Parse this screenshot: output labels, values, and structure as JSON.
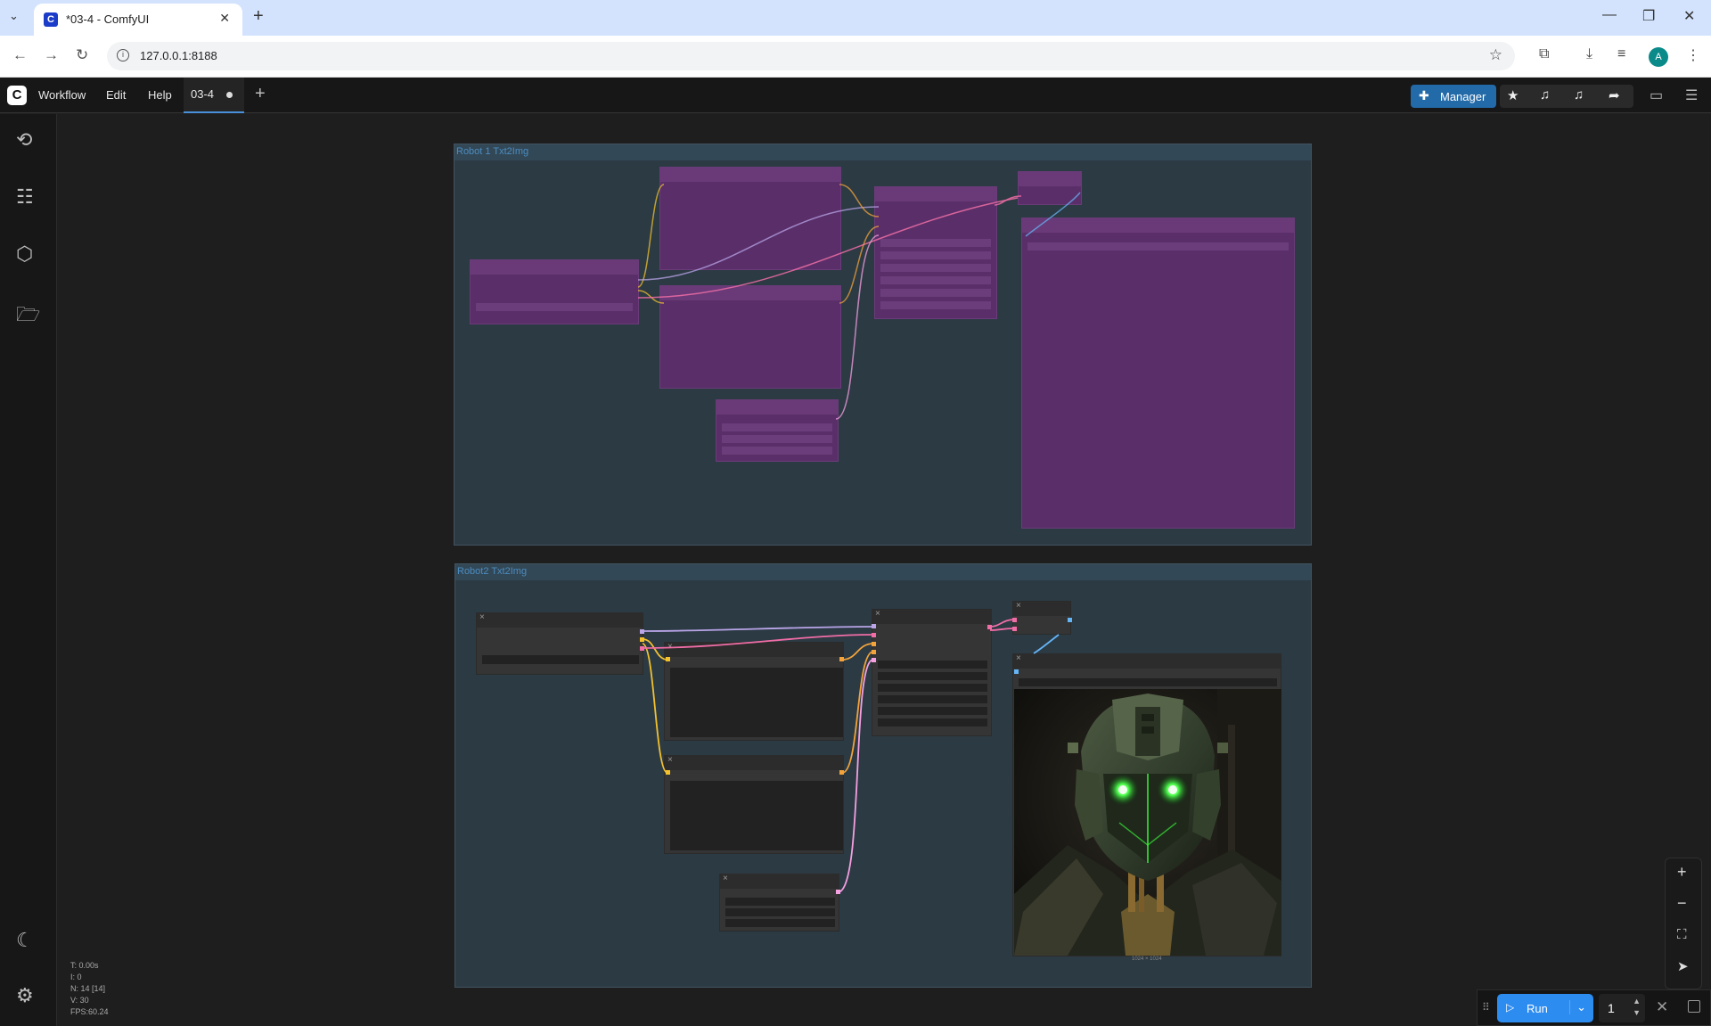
{
  "browser": {
    "tab_title": "*03-4 - ComfyUI",
    "url": "127.0.0.1:8188",
    "profile_initial": "A"
  },
  "app": {
    "menu": [
      "Workflow",
      "Edit",
      "Help"
    ],
    "workflow_tab": "03-4",
    "manager_label": "Manager"
  },
  "canvas": {
    "groups": [
      {
        "title": "Robot 1 Txt2Img",
        "state": "bypassed"
      },
      {
        "title": "Robot2 Txt2Img",
        "state": "active"
      }
    ],
    "image_caption": "1024 × 1024"
  },
  "stats": {
    "t": "T: 0.00s",
    "i": "I: 0",
    "n": "N: 14 [14]",
    "v": "V: 30",
    "fps": "FPS:60.24"
  },
  "run": {
    "label": "Run",
    "count": "1"
  },
  "colors": {
    "bypass_purple": "#5a2f69",
    "group_bg": "#2c3a44",
    "accent_blue": "#2d8cf0",
    "wire_yellow": "#f2c12e",
    "wire_pink": "#f06da6",
    "wire_lavender": "#b9a5e8",
    "wire_blue": "#64b5f6"
  }
}
